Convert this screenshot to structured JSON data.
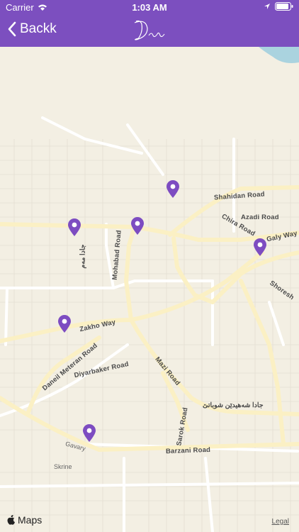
{
  "status_bar": {
    "carrier": "Carrier",
    "time": "1:03 AM"
  },
  "nav": {
    "back_label": "Backk",
    "logo_text": "Deni"
  },
  "map": {
    "road_labels": {
      "shahidan": "Shahidan Road",
      "azadi": "Azadi Road",
      "chira": "Chira Road",
      "galy": "Galy Way",
      "shoresh": "Shoresh",
      "mohabad": "Mohabad Road",
      "jada_mam": "جادا مەم",
      "zakho": "Zakho Way",
      "daneil": "Daneil Meteran Road",
      "diyarbaker": "Diyarbaker Road",
      "mazi": "Mazi Road",
      "sarok": "Sarok Road",
      "jada_shahidan": "جادا شەهیدێن شوباتێ",
      "barzani": "Barzani Road"
    },
    "place_labels": {
      "gavary": "Gavary",
      "skrine": "Skrine"
    },
    "pin_color": "#7d4cc1",
    "pins": [
      "pin-1",
      "pin-2",
      "pin-3",
      "pin-4",
      "pin-5",
      "pin-6"
    ]
  },
  "footer": {
    "maps_label": "Maps",
    "legal_label": "Legal"
  },
  "colors": {
    "accent": "#7c4fbf",
    "map_bg": "#f3efe3",
    "road_major": "#fbf3cf"
  }
}
